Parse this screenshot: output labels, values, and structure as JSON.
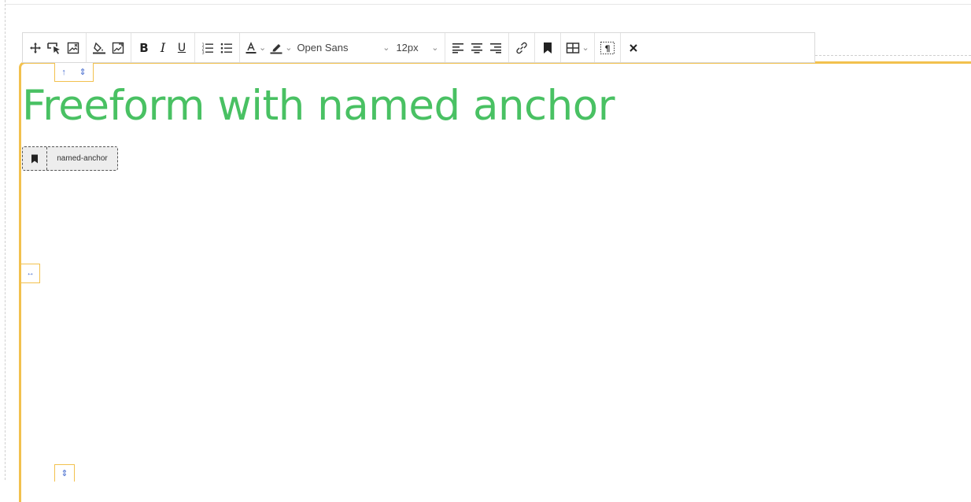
{
  "toolbar": {
    "font_family": "Open Sans",
    "font_size": "12px",
    "icons": [
      "move-icon",
      "select-icon",
      "image-icon",
      "fill-icon",
      "image-edit-icon",
      "bold",
      "italic",
      "underline",
      "ordered-list-icon",
      "unordered-list-icon",
      "text-color-icon",
      "highlight-icon",
      "align-left-icon",
      "align-center-icon",
      "align-right-icon",
      "link-icon",
      "bookmark-icon",
      "table-icon",
      "paragraph-marks-icon",
      "close-icon"
    ],
    "bold_label": "B",
    "italic_label": "I",
    "underline_label": "U"
  },
  "content": {
    "heading": "Freeform with named anchor",
    "anchor_name": "named-anchor"
  },
  "colors": {
    "heading": "#49c163",
    "block_border": "#f2c14e",
    "handle_icon": "#4a6fd0"
  }
}
